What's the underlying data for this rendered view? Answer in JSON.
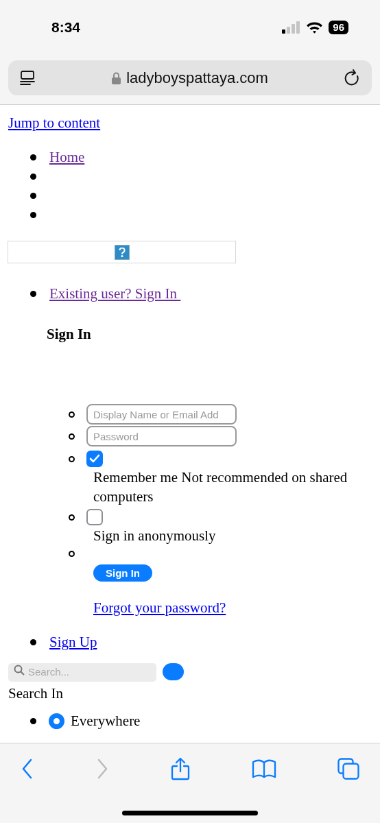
{
  "status_bar": {
    "time": "8:34",
    "battery": "96"
  },
  "address_bar": {
    "url": "ladyboyspattaya.com"
  },
  "page": {
    "skip_link": "Jump to content",
    "nav_items": [
      {
        "kind": "link",
        "label": "Home",
        "visited": true
      },
      {
        "kind": "empty"
      },
      {
        "kind": "empty"
      },
      {
        "kind": "empty"
      }
    ],
    "account_link": {
      "label": "Existing user? Sign In ",
      "visited": true
    },
    "sign_in": {
      "heading": "Sign In",
      "username_placeholder": "Display Name or Email Add",
      "password_placeholder": "Password",
      "remember": {
        "label": "Remember me Not recommended on shared computers",
        "checked": true
      },
      "anonymous": {
        "label": "Sign in anonymously",
        "checked": false
      },
      "button": "Sign In",
      "forgot_link": "Forgot your password?"
    },
    "sign_up_link": "Sign Up",
    "search": {
      "placeholder": "Search...",
      "scope_label": "Search In",
      "scopes": [
        {
          "label": "Everywhere",
          "selected": true
        }
      ]
    }
  },
  "toolbar": {
    "back_enabled": true,
    "forward_enabled": false
  }
}
